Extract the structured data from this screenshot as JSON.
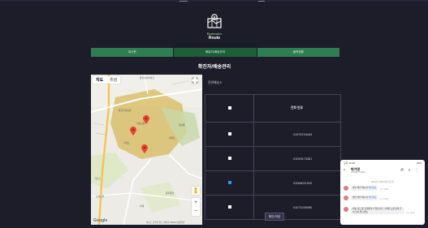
{
  "logo": {
    "line1": "Reminder",
    "line2": "Route"
  },
  "nav": {
    "tabs": [
      {
        "label": "대시판",
        "active": false
      },
      {
        "label": "배달지/배송관리",
        "active": true
      },
      {
        "label": "출력현황",
        "active": false
      }
    ]
  },
  "page": {
    "title": "확진자/배송관리"
  },
  "content": {
    "subhead": "진면배송소",
    "table": {
      "header": {
        "phone": "전화 번호"
      },
      "rows": [
        {
          "phone": "01076724443",
          "checked": false
        },
        {
          "phone": "01059173381",
          "checked": false
        },
        {
          "phone": "01066021920",
          "checked": true
        },
        {
          "phone": "01071035080",
          "checked": false
        }
      ]
    },
    "save_label": "확인/저장"
  },
  "map": {
    "tabs": [
      "지도",
      "위성"
    ],
    "google": "Google",
    "attribution": "키보드 단축키  지도 데이터 ©2022  이용약관",
    "labels": [
      "용인마을아파트",
      "지정고등",
      "용인근린공원",
      "국향도",
      "아파트",
      "죽전동",
      "기흥구",
      "도성마을",
      "뫼재",
      "용인종합"
    ],
    "marker_color": "#ea4335"
  },
  "phone": {
    "status_left": "오후 12:48",
    "status_right": "94%",
    "name": "박가영",
    "number": "010-8577-4020",
    "date": "2022년 11월 24일 목요일",
    "messages": [
      {
        "text": "범인 확인 메시지 ",
        "link": "확인완료",
        "time": "오후 12:43"
      },
      {
        "text": "범인 확인 메시지 ",
        "link": "확인완료",
        "time": "오후 12:44"
      },
      {
        "text": "이동 경로 중 감염환자가 있습니다. 가까운 보건소에 가서 검사 받으세요",
        "link": "",
        "time": "오후 12:48"
      }
    ]
  }
}
